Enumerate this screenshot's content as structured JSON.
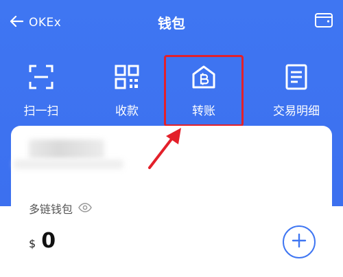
{
  "header": {
    "back_label": "OKEx",
    "title": "钱包"
  },
  "actions": [
    {
      "label": "扫一扫",
      "icon": "scan-icon"
    },
    {
      "label": "收款",
      "icon": "qr-code-icon"
    },
    {
      "label": "转账",
      "icon": "transfer-bitcoin-house-icon"
    },
    {
      "label": "交易明细",
      "icon": "document-list-icon"
    }
  ],
  "wallet": {
    "name": "多链钱包",
    "currency": "$",
    "balance": "0"
  },
  "colors": {
    "header_blue": "#3f76f2",
    "highlight_red": "#e3202a"
  }
}
